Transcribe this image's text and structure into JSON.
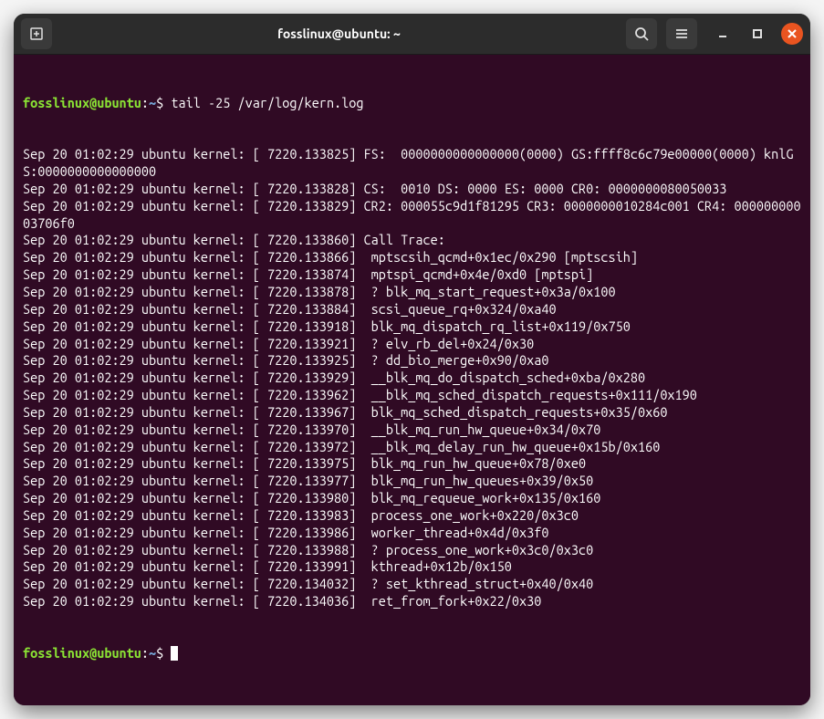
{
  "titlebar": {
    "title": "fosslinux@ubuntu: ~"
  },
  "prompt": {
    "user_host": "fosslinux@ubuntu",
    "path": "~",
    "command": "tail -25 /var/log/kern.log"
  },
  "output": [
    "Sep 20 01:02:29 ubuntu kernel: [ 7220.133825] FS:  0000000000000000(0000) GS:ffff8c6c79e00000(0000) knlGS:0000000000000000",
    "Sep 20 01:02:29 ubuntu kernel: [ 7220.133828] CS:  0010 DS: 0000 ES: 0000 CR0: 0000000080050033",
    "Sep 20 01:02:29 ubuntu kernel: [ 7220.133829] CR2: 000055c9d1f81295 CR3: 0000000010284c001 CR4: 00000000003706f0",
    "Sep 20 01:02:29 ubuntu kernel: [ 7220.133860] Call Trace:",
    "Sep 20 01:02:29 ubuntu kernel: [ 7220.133866]  mptscsih_qcmd+0x1ec/0x290 [mptscsih]",
    "Sep 20 01:02:29 ubuntu kernel: [ 7220.133874]  mptspi_qcmd+0x4e/0xd0 [mptspi]",
    "Sep 20 01:02:29 ubuntu kernel: [ 7220.133878]  ? blk_mq_start_request+0x3a/0x100",
    "Sep 20 01:02:29 ubuntu kernel: [ 7220.133884]  scsi_queue_rq+0x324/0xa40",
    "Sep 20 01:02:29 ubuntu kernel: [ 7220.133918]  blk_mq_dispatch_rq_list+0x119/0x750",
    "Sep 20 01:02:29 ubuntu kernel: [ 7220.133921]  ? elv_rb_del+0x24/0x30",
    "Sep 20 01:02:29 ubuntu kernel: [ 7220.133925]  ? dd_bio_merge+0x90/0xa0",
    "Sep 20 01:02:29 ubuntu kernel: [ 7220.133929]  __blk_mq_do_dispatch_sched+0xba/0x280",
    "Sep 20 01:02:29 ubuntu kernel: [ 7220.133962]  __blk_mq_sched_dispatch_requests+0x111/0x190",
    "Sep 20 01:02:29 ubuntu kernel: [ 7220.133967]  blk_mq_sched_dispatch_requests+0x35/0x60",
    "Sep 20 01:02:29 ubuntu kernel: [ 7220.133970]  __blk_mq_run_hw_queue+0x34/0x70",
    "Sep 20 01:02:29 ubuntu kernel: [ 7220.133972]  __blk_mq_delay_run_hw_queue+0x15b/0x160",
    "Sep 20 01:02:29 ubuntu kernel: [ 7220.133975]  blk_mq_run_hw_queue+0x78/0xe0",
    "Sep 20 01:02:29 ubuntu kernel: [ 7220.133977]  blk_mq_run_hw_queues+0x39/0x50",
    "Sep 20 01:02:29 ubuntu kernel: [ 7220.133980]  blk_mq_requeue_work+0x135/0x160",
    "Sep 20 01:02:29 ubuntu kernel: [ 7220.133983]  process_one_work+0x220/0x3c0",
    "Sep 20 01:02:29 ubuntu kernel: [ 7220.133986]  worker_thread+0x4d/0x3f0",
    "Sep 20 01:02:29 ubuntu kernel: [ 7220.133988]  ? process_one_work+0x3c0/0x3c0",
    "Sep 20 01:02:29 ubuntu kernel: [ 7220.133991]  kthread+0x12b/0x150",
    "Sep 20 01:02:29 ubuntu kernel: [ 7220.134032]  ? set_kthread_struct+0x40/0x40",
    "Sep 20 01:02:29 ubuntu kernel: [ 7220.134036]  ret_from_fork+0x22/0x30"
  ],
  "prompt2": {
    "user_host": "fosslinux@ubuntu",
    "path": "~"
  }
}
